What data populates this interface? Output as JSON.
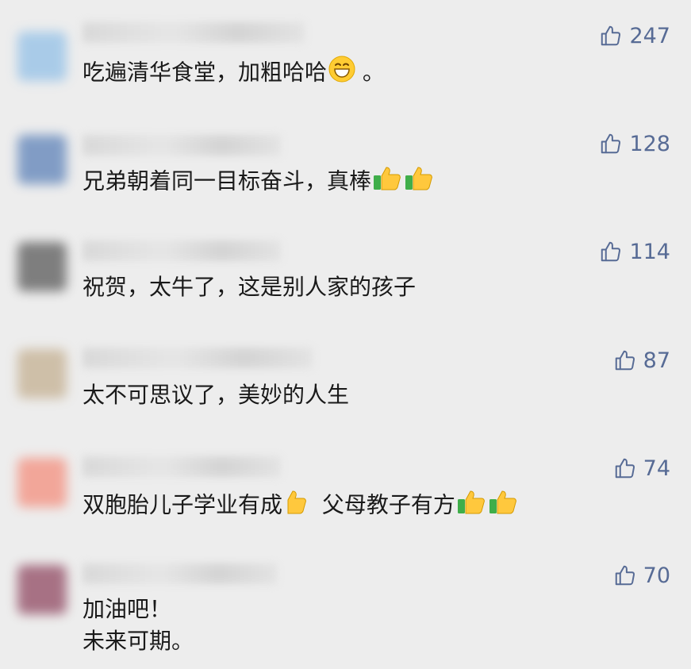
{
  "comments": [
    {
      "likes": "247",
      "text": "吃遍清华食堂，加粗哈哈",
      "suffix": " 。",
      "avatar_color": "#9ec6e8"
    },
    {
      "likes": "128",
      "text": "兄弟朝着同一目标奋斗，真棒",
      "avatar_color": "#6f8fbf"
    },
    {
      "likes": "114",
      "text": "祝贺，太牛了，这是别人家的孩子",
      "avatar_color": "#6b6b6b"
    },
    {
      "likes": "87",
      "text": "太不可思议了，美妙的人生",
      "avatar_color": "#c9b79c"
    },
    {
      "likes": "74",
      "text": "双胞胎儿子学业有成",
      "text2": "父母教子有方",
      "avatar_color": "#f39a8b"
    },
    {
      "likes": "70",
      "text": "加油吧！",
      "text2": "未来可期。",
      "avatar_color": "#9b5c72"
    }
  ],
  "icons": {
    "like": "thumbs-up-outline-icon",
    "smile": "grinning-face-emoji",
    "thumb": "thumbs-up-emoji"
  },
  "colors": {
    "like": "#576b95",
    "text": "#1a1a1a",
    "background": "#ededed"
  }
}
